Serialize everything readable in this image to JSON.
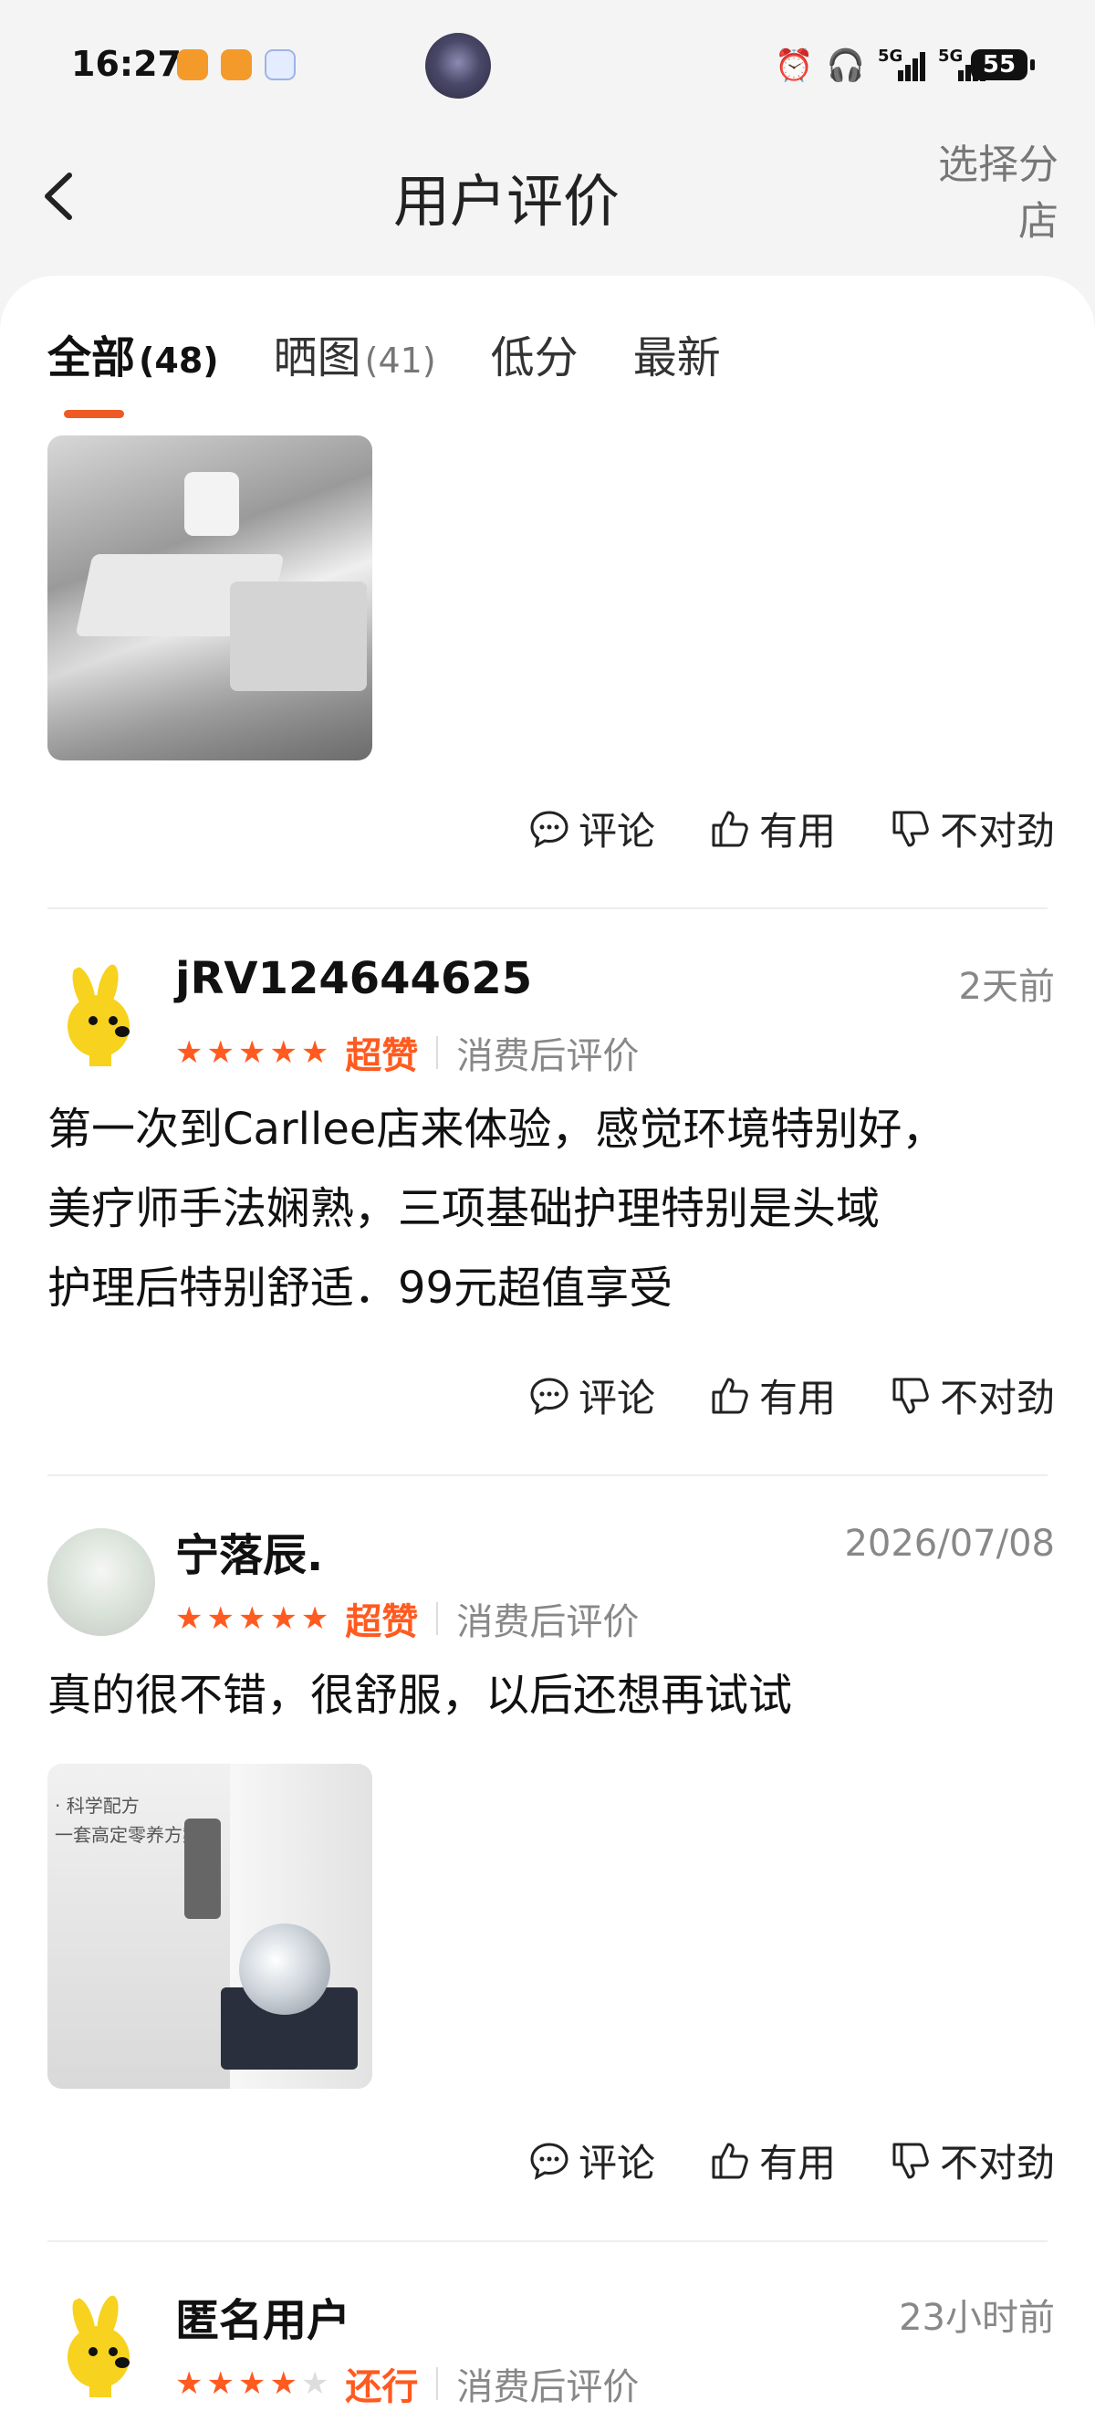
{
  "status_bar": {
    "time": "16:27",
    "battery": "55",
    "network": "5G"
  },
  "header": {
    "title": "用户评价",
    "branch_select": "选择分店",
    "branch_line1": "选择分",
    "branch_line2": "店"
  },
  "tabs": [
    {
      "label": "全部",
      "count": "(48)"
    },
    {
      "label": "晒图",
      "count": "(41)"
    },
    {
      "label": "低分",
      "count": ""
    },
    {
      "label": "最新",
      "count": ""
    }
  ],
  "actions": {
    "comment": "评论",
    "useful": "有用",
    "wrong": "不对劲"
  },
  "reviews": [
    {
      "user": "jRV124644625",
      "date": "2天前",
      "rating": 5,
      "level": "超赞",
      "tag": "消费后评价",
      "text_line1": "第一次到Carllee店来体验，感觉环境特别好，",
      "text_line2": "美疗师手法娴熟，三项基础护理特别是头域",
      "text_line3": "护理后特别舒适．99元超值享受"
    },
    {
      "user": "宁落辰.",
      "date": "2026/07/08",
      "rating": 5,
      "level": "超赞",
      "tag": "消费后评价",
      "text_line1": "真的很不错，很舒服，以后还想再试试",
      "photo_text1": "· 科学配方",
      "photo_text2": "一套高定零养方案"
    },
    {
      "user": "匿名用户",
      "date": "23小时前",
      "rating": 4,
      "level": "还行",
      "tag": "消费后评价"
    }
  ]
}
